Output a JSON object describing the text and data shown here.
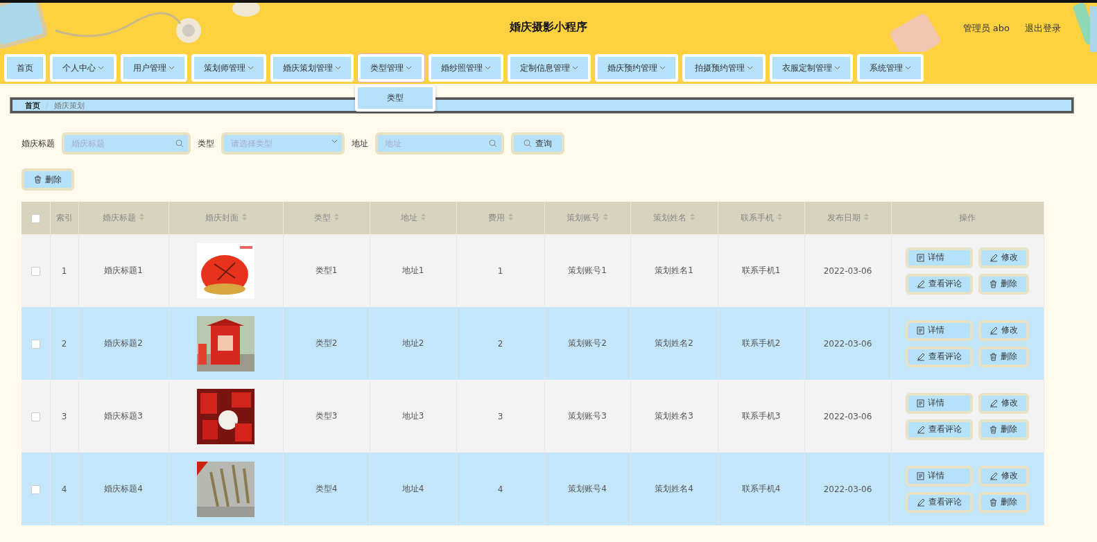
{
  "header": {
    "title": "婚庆摄影小程序",
    "user": "管理员 abo",
    "logout": "退出登录"
  },
  "nav": [
    {
      "label": "首页",
      "dropdown": false,
      "expanded": false
    },
    {
      "label": "个人中心",
      "dropdown": true,
      "expanded": false
    },
    {
      "label": "用户管理",
      "dropdown": true,
      "expanded": false
    },
    {
      "label": "策划师管理",
      "dropdown": true,
      "expanded": false
    },
    {
      "label": "婚庆策划管理",
      "dropdown": true,
      "expanded": false
    },
    {
      "label": "类型管理",
      "dropdown": true,
      "expanded": true,
      "children": [
        "类型"
      ]
    },
    {
      "label": "婚纱照管理",
      "dropdown": true,
      "expanded": false
    },
    {
      "label": "定制信息管理",
      "dropdown": true,
      "expanded": false
    },
    {
      "label": "婚庆预约管理",
      "dropdown": true,
      "expanded": false
    },
    {
      "label": "拍摄预约管理",
      "dropdown": true,
      "expanded": false
    },
    {
      "label": "衣服定制管理",
      "dropdown": true,
      "expanded": false
    },
    {
      "label": "系统管理",
      "dropdown": true,
      "expanded": false
    }
  ],
  "breadcrumb": {
    "items": [
      "首页",
      "婚庆策划"
    ],
    "separator": "/"
  },
  "search": [
    {
      "label": "婚庆标题",
      "placeholder": "婚庆标题",
      "kind": "text"
    },
    {
      "label": "类型",
      "placeholder": "请选择类型",
      "kind": "select"
    },
    {
      "label": "地址",
      "placeholder": "地址",
      "kind": "text"
    }
  ],
  "search_button": "查询",
  "delete_button": "删除",
  "table": {
    "columns": [
      {
        "label": "索引",
        "sortable": false
      },
      {
        "label": "婚庆标题",
        "sortable": true
      },
      {
        "label": "婚庆封面",
        "sortable": true
      },
      {
        "label": "类型",
        "sortable": true
      },
      {
        "label": "地址",
        "sortable": true
      },
      {
        "label": "费用",
        "sortable": true
      },
      {
        "label": "策划账号",
        "sortable": true
      },
      {
        "label": "策划姓名",
        "sortable": true
      },
      {
        "label": "联系手机",
        "sortable": true
      },
      {
        "label": "发布日期",
        "sortable": true
      },
      {
        "label": "操作",
        "sortable": false
      }
    ],
    "header_checked": false,
    "rows": [
      {
        "checked": false,
        "cells": [
          "1",
          "婚庆标题1",
          {
            "kind": "picture"
          },
          "类型1",
          "地址1",
          "1",
          "策划账号1",
          "策划姓名1",
          "联系手机1",
          "2022-03-06"
        ],
        "actions": [
          {
            "kind": "detail",
            "label": "详情"
          },
          {
            "kind": "edit",
            "label": "修改"
          },
          {
            "kind": "edit",
            "label": "查看评论"
          },
          {
            "kind": "delete",
            "label": "删除"
          }
        ]
      },
      {
        "checked": false,
        "cells": [
          "2",
          "婚庆标题2",
          {
            "kind": "picture"
          },
          "类型2",
          "地址2",
          "2",
          "策划账号2",
          "策划姓名2",
          "联系手机2",
          "2022-03-06"
        ],
        "actions": [
          {
            "kind": "detail",
            "label": "详情"
          },
          {
            "kind": "edit",
            "label": "修改"
          },
          {
            "kind": "edit",
            "label": "查看评论"
          },
          {
            "kind": "delete",
            "label": "删除"
          }
        ]
      },
      {
        "checked": false,
        "cells": [
          "3",
          "婚庆标题3",
          {
            "kind": "picture"
          },
          "类型3",
          "地址3",
          "3",
          "策划账号3",
          "策划姓名3",
          "联系手机3",
          "2022-03-06"
        ],
        "actions": [
          {
            "kind": "detail",
            "label": "详情"
          },
          {
            "kind": "edit",
            "label": "修改"
          },
          {
            "kind": "edit",
            "label": "查看评论"
          },
          {
            "kind": "delete",
            "label": "删除"
          }
        ]
      },
      {
        "checked": false,
        "cells": [
          "4",
          "婚庆标题4",
          {
            "kind": "picture"
          },
          "类型4",
          "地址4",
          "4",
          "策划账号4",
          "策划姓名4",
          "联系手机4",
          "2022-03-06"
        ],
        "actions": [
          {
            "kind": "detail",
            "label": "详情"
          },
          {
            "kind": "edit",
            "label": "修改"
          },
          {
            "kind": "edit",
            "label": "查看评论"
          },
          {
            "kind": "delete",
            "label": "删除"
          }
        ]
      }
    ]
  }
}
